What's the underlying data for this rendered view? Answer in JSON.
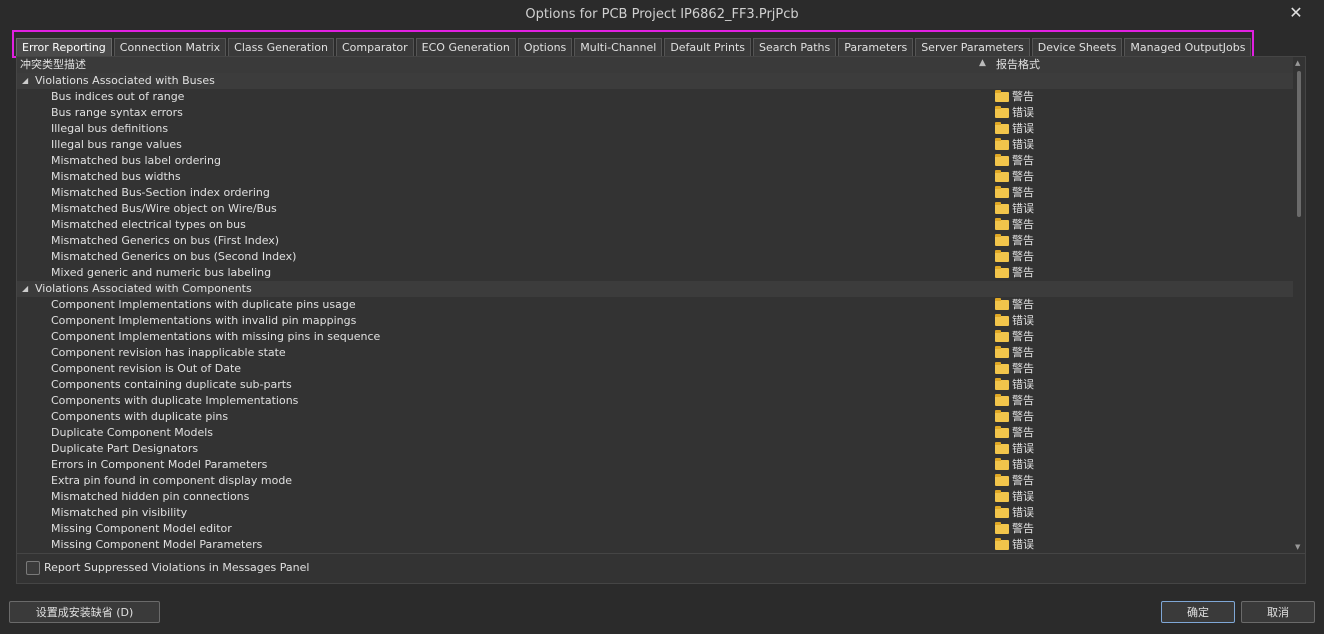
{
  "window": {
    "title": "Options for PCB Project IP6862_FF3.PrjPcb",
    "close_glyph": "✕"
  },
  "tabs": [
    {
      "label": "Error Reporting",
      "active": true
    },
    {
      "label": "Connection Matrix"
    },
    {
      "label": "Class Generation"
    },
    {
      "label": "Comparator"
    },
    {
      "label": "ECO Generation"
    },
    {
      "label": "Options"
    },
    {
      "label": "Multi-Channel"
    },
    {
      "label": "Default Prints"
    },
    {
      "label": "Search Paths"
    },
    {
      "label": "Parameters"
    },
    {
      "label": "Server Parameters"
    },
    {
      "label": "Device Sheets"
    },
    {
      "label": "Managed OutputJobs"
    }
  ],
  "table": {
    "col_violation": "冲突类型描述",
    "col_report": "报告格式",
    "groups": [
      {
        "label": "Violations Associated with Buses",
        "items": [
          {
            "label": "Bus indices out of range",
            "status": "警告"
          },
          {
            "label": "Bus range syntax errors",
            "status": "错误"
          },
          {
            "label": "Illegal bus definitions",
            "status": "错误"
          },
          {
            "label": "Illegal bus range values",
            "status": "错误"
          },
          {
            "label": "Mismatched bus label ordering",
            "status": "警告"
          },
          {
            "label": "Mismatched bus widths",
            "status": "警告"
          },
          {
            "label": "Mismatched Bus-Section index ordering",
            "status": "警告"
          },
          {
            "label": "Mismatched Bus/Wire object on Wire/Bus",
            "status": "错误"
          },
          {
            "label": "Mismatched electrical types on bus",
            "status": "警告"
          },
          {
            "label": "Mismatched Generics on bus (First Index)",
            "status": "警告"
          },
          {
            "label": "Mismatched Generics on bus (Second Index)",
            "status": "警告"
          },
          {
            "label": "Mixed generic and numeric bus labeling",
            "status": "警告"
          }
        ]
      },
      {
        "label": "Violations Associated with Components",
        "items": [
          {
            "label": "Component Implementations with duplicate pins usage",
            "status": "警告"
          },
          {
            "label": "Component Implementations with invalid pin mappings",
            "status": "错误"
          },
          {
            "label": "Component Implementations with missing pins in sequence",
            "status": "警告"
          },
          {
            "label": "Component revision has inapplicable state",
            "status": "警告"
          },
          {
            "label": "Component revision is Out of Date",
            "status": "警告"
          },
          {
            "label": "Components containing duplicate sub-parts",
            "status": "错误"
          },
          {
            "label": "Components with duplicate Implementations",
            "status": "警告"
          },
          {
            "label": "Components with duplicate pins",
            "status": "警告"
          },
          {
            "label": "Duplicate Component Models",
            "status": "警告"
          },
          {
            "label": "Duplicate Part Designators",
            "status": "错误"
          },
          {
            "label": "Errors in Component Model Parameters",
            "status": "错误"
          },
          {
            "label": "Extra pin found in component display mode",
            "status": "警告"
          },
          {
            "label": "Mismatched hidden pin connections",
            "status": "错误"
          },
          {
            "label": "Mismatched pin visibility",
            "status": "错误"
          },
          {
            "label": "Missing Component Model editor",
            "status": "警告"
          },
          {
            "label": "Missing Component Model Parameters",
            "status": "错误"
          }
        ]
      }
    ]
  },
  "options": {
    "report_suppressed_label": "Report Suppressed Violations in Messages Panel",
    "report_suppressed_checked": false
  },
  "buttons": {
    "set_defaults": "设置成安装缺省 (D)",
    "ok": "确定",
    "cancel": "取消"
  },
  "colors": {
    "highlight_box": "#e020e0",
    "folder": "#f2c54b"
  }
}
